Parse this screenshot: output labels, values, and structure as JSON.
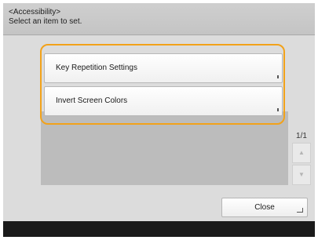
{
  "header": {
    "title": "<Accessibility>\nSelect an item to set."
  },
  "items": [
    {
      "label": "Key Repetition Settings"
    },
    {
      "label": "Invert Screen Colors"
    }
  ],
  "pager": {
    "text": "1/1"
  },
  "scroll": {
    "up_icon": "▲",
    "down_icon": "▼"
  },
  "footer": {
    "close_label": "Close"
  },
  "colors": {
    "highlight": "#f2a21a",
    "bottom_bar": "#1a1a1a"
  }
}
